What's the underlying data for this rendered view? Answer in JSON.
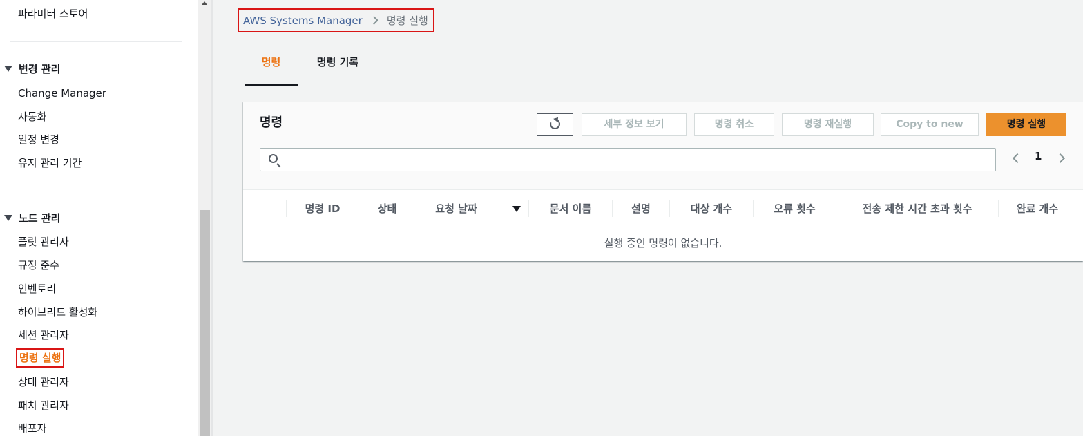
{
  "sidebar": {
    "top_item": "파라미터 스토어",
    "change_section": {
      "heading": "변경 관리",
      "items": [
        "Change Manager",
        "자동화",
        "일정 변경",
        "유지 관리 기간"
      ]
    },
    "node_section": {
      "heading": "노드 관리",
      "items": [
        "플릿 관리자",
        "규정 준수",
        "인벤토리",
        "하이브리드 활성화",
        "세션 관리자",
        "명령 실행",
        "상태 관리자",
        "패치 관리자",
        "배포자"
      ]
    },
    "active_item": "명령 실행"
  },
  "breadcrumb": {
    "root": "AWS Systems Manager",
    "current": "명령 실행"
  },
  "tabs": [
    {
      "label": "명령",
      "active": true
    },
    {
      "label": "명령 기록",
      "active": false
    }
  ],
  "panel": {
    "title": "명령",
    "buttons": {
      "details": "세부 정보 보기",
      "cancel": "명령 취소",
      "rerun": "명령 재실행",
      "copy": "Copy to new",
      "run": "명령 실행"
    },
    "search_placeholder": "",
    "page_number": "1",
    "columns": [
      "명령 ID",
      "상태",
      "요청 날짜",
      "문서 이름",
      "설명",
      "대상 개수",
      "오류 횟수",
      "전송 제한 시간 초과 횟수",
      "완료 개수"
    ],
    "sorted_column": "요청 날짜",
    "empty_message": "실행 중인 명령이 없습니다."
  },
  "colors": {
    "accent_orange": "#ec7211",
    "primary_button": "#ec912d",
    "highlight_border": "#d91515",
    "link": "#44649a"
  }
}
